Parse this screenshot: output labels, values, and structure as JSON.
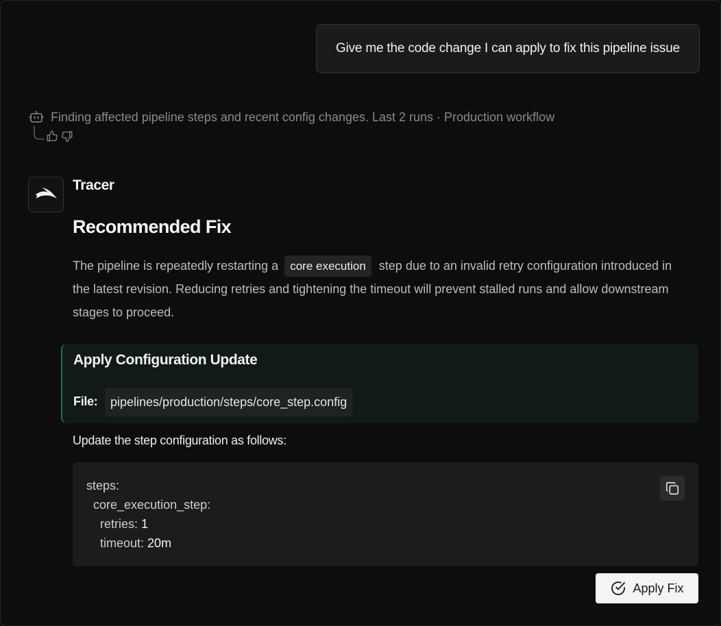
{
  "user_message": {
    "text": "Give me the code change I can apply to fix this pipeline issue"
  },
  "status": {
    "icon": "robot-icon",
    "text": "Finding affected pipeline steps and recent config changes. Last 2 runs · Production workflow"
  },
  "feedback": {
    "icons": [
      "thumbs-up-icon",
      "thumbs-down-icon"
    ]
  },
  "agent": {
    "name": "Tracer",
    "avatar_icon": "tracer-logo-icon"
  },
  "response": {
    "heading": "Recommended Fix",
    "paragraph_before": "The pipeline is repeatedly restarting a",
    "inline_code": "core execution",
    "paragraph_after": "step due to an invalid retry configuration introduced in the latest revision. Reducing retries and tightening the timeout will prevent stalled runs and allow downstream stages to proceed."
  },
  "config_card": {
    "title": "Apply Configuration Update",
    "file_label": "File:",
    "file_path": "pipelines/production/steps/core_step.config"
  },
  "instruction": "Update the step configuration as follows:",
  "code": {
    "line1": "steps:",
    "line2": "core_execution_step:",
    "line3_key": "retries: ",
    "line3_val": "1",
    "line4_key": "timeout: ",
    "line4_val": "20m",
    "copy_icon": "copy-icon"
  },
  "actions": {
    "apply_label": "Apply Fix",
    "apply_icon": "check-circle-icon"
  },
  "colors": {
    "background": "#0d0d0d",
    "card_accent": "#2f6a58",
    "card_background": "#111a17",
    "code_background": "#1c1c1c",
    "button_background": "#f4f4f4"
  }
}
